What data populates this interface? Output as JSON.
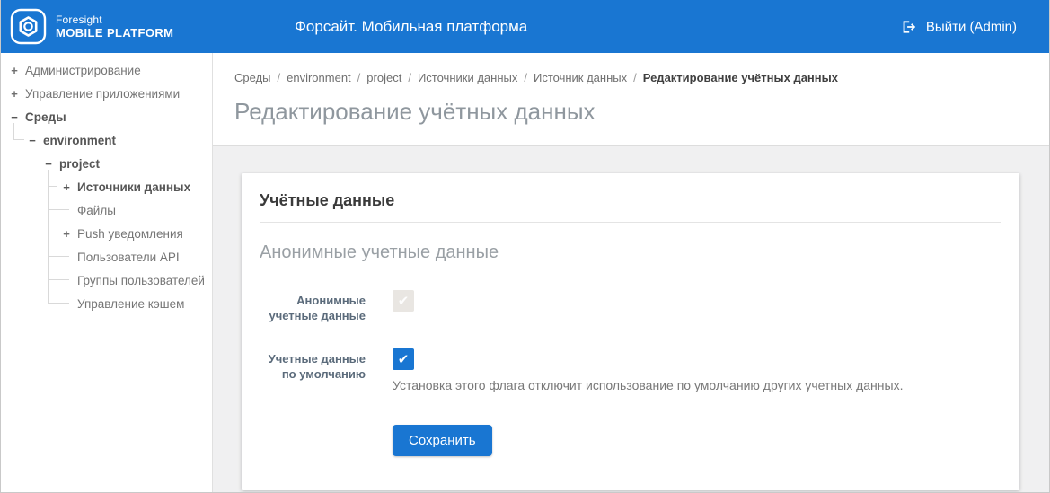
{
  "topbar": {
    "logo": {
      "line1": "Foresight",
      "line2": "MOBILE PLATFORM"
    },
    "title": "Форсайт. Мобильная платформа",
    "logout_label": "Выйти (Admin)"
  },
  "sidebar": {
    "items": [
      {
        "label": "Администрирование",
        "toggle": "+"
      },
      {
        "label": "Управление приложениями",
        "toggle": "+"
      },
      {
        "label": "Среды",
        "toggle": "−"
      },
      {
        "label": "environment",
        "toggle": "−"
      },
      {
        "label": "project",
        "toggle": "−"
      },
      {
        "label": "Источники данных",
        "toggle": "+"
      },
      {
        "label": "Файлы",
        "toggle": ""
      },
      {
        "label": "Push уведомления",
        "toggle": "+"
      },
      {
        "label": "Пользователи API",
        "toggle": ""
      },
      {
        "label": "Группы пользователей",
        "toggle": ""
      },
      {
        "label": "Управление кэшем",
        "toggle": ""
      }
    ]
  },
  "breadcrumb": {
    "separator": "/",
    "items": [
      "Среды",
      "environment",
      "project",
      "Источники данных",
      "Источник данных",
      "Редактирование учётных данных"
    ]
  },
  "page": {
    "title": "Редактирование учётных данных"
  },
  "card": {
    "title": "Учётные данные",
    "subtitle": "Анонимные учетные данные",
    "fields": [
      {
        "label": "Анонимные учетные данные",
        "checked": true,
        "disabled": true
      },
      {
        "label": "Учетные данные по умолчанию",
        "checked": true,
        "disabled": false,
        "hint": "Установка этого флага отключит использование по умолчанию других учетных данных."
      }
    ],
    "save_label": "Сохранить"
  },
  "icons": {
    "check_glyph": "✔"
  },
  "colors": {
    "accent": "#1976d2",
    "topbar": "#1976d2",
    "content_bg": "#f0f0f1"
  }
}
